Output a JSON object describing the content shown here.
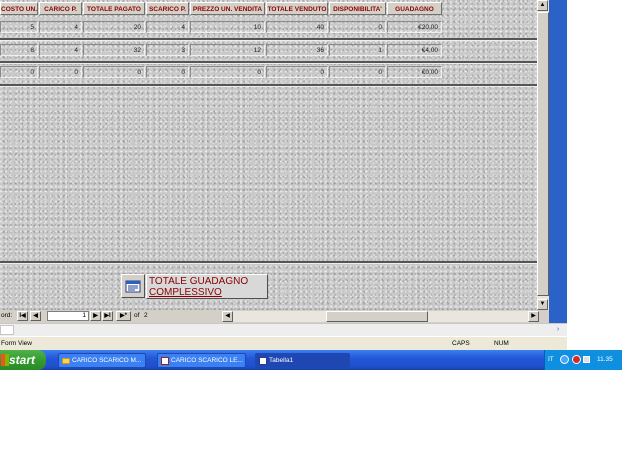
{
  "columns": [
    "COSTO UN.",
    "CARICO P.",
    "TOTALE PAGATO",
    "SCARICO P.",
    "PREZZO UN. VENDITA",
    "TOTALE VENDUTO",
    "DISPONIBILITA'",
    "GUADAGNO"
  ],
  "rows": [
    [
      "5",
      "4",
      "20",
      "4",
      "10",
      "40",
      "0",
      "€20,00"
    ],
    [
      "8",
      "4",
      "32",
      "3",
      "12",
      "36",
      "1",
      "€4,00"
    ],
    [
      "0",
      "0",
      "0",
      "0",
      "0",
      "0",
      "0",
      "€0,00"
    ]
  ],
  "total_button": {
    "label_line1": "TOTALE GUADAGNO",
    "label_line2": "COMPLESSIVO"
  },
  "record_nav": {
    "prefix": "ord:",
    "current": "1",
    "of_label": "of",
    "total": "2"
  },
  "status": {
    "view": "Form View",
    "caps": "CAPS",
    "num": "NUM"
  },
  "taskbar": {
    "start": "start",
    "tasks": [
      "CARICO SCARICO M...",
      "CARICO SCARICO LE...",
      "Tabella1"
    ],
    "lang": "IT",
    "clock": "11.35"
  }
}
